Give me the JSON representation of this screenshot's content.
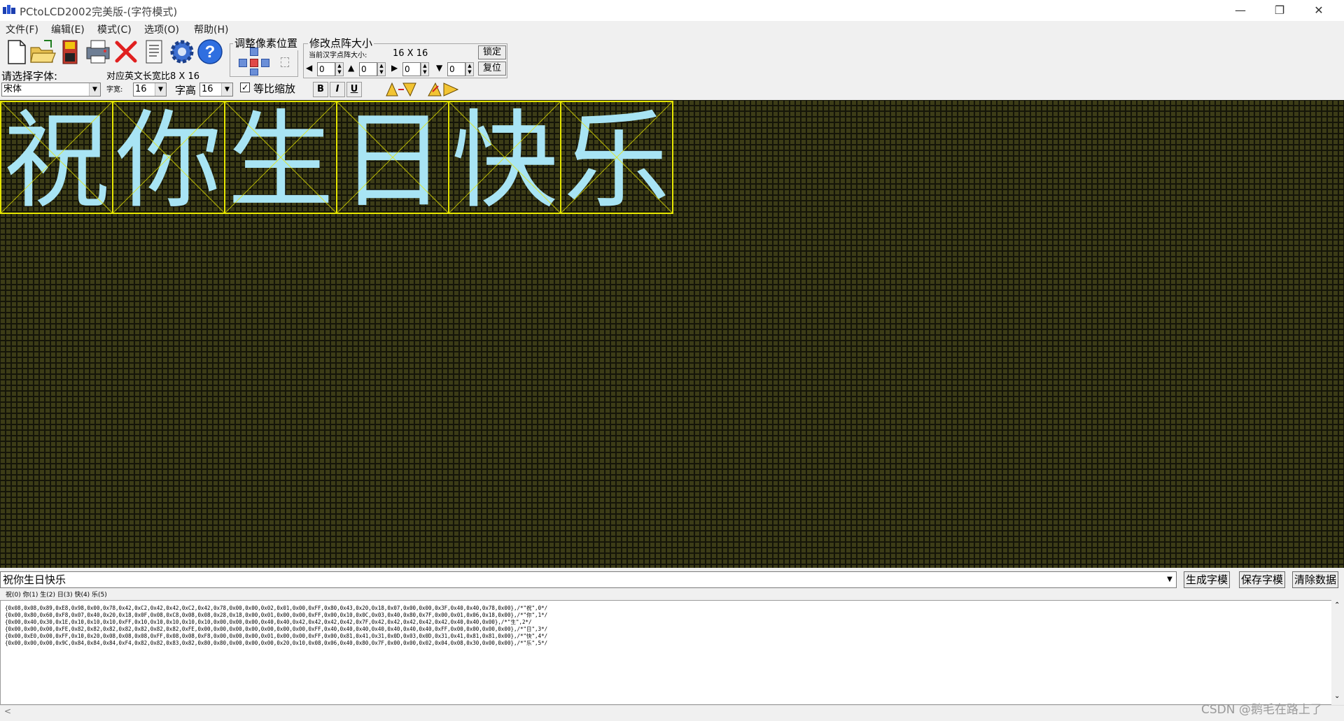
{
  "window": {
    "title": "PCtoLCD2002完美版-(字符模式)",
    "controls": [
      "minimize-icon",
      "restore-icon",
      "close-icon"
    ]
  },
  "menu": [
    "文件(F)",
    "编辑(E)",
    "模式(C)",
    "选项(O)",
    "帮助(H)"
  ],
  "toolbar": {
    "buttons": [
      "new-file-icon",
      "open-folder-icon",
      "save-disk-icon",
      "print-icon",
      "delete-x-icon",
      "document-icon",
      "gear-icon",
      "help-icon"
    ],
    "font_label": "请选择字体:",
    "font_value": "宋体",
    "ratio_label": "对应英文长宽比8 X 16",
    "width_label": "字宽:",
    "width_value": "16",
    "height_label": "字高",
    "height_value": "16",
    "proportional_label": "等比缩放",
    "proportional_checked": true,
    "format_buttons": [
      "B",
      "I",
      "U"
    ],
    "adjust_pixel_group": "调整像素位置",
    "matrix_group": "修改点阵大小",
    "current_matrix_label": "当前汉字点阵大小:",
    "current_matrix_value": "16 X 16",
    "lock_button": "锁定",
    "reset_button": "复位",
    "spin_values": [
      "0",
      "0",
      "0",
      "0"
    ]
  },
  "canvas": {
    "characters": [
      "祝",
      "你",
      "生",
      "日",
      "快",
      "乐"
    ],
    "background_color": "#3b3b16",
    "pixel_on_color": "#a8e4f4",
    "frame_color": "#e6e600"
  },
  "bottom": {
    "input_text": "祝你生日快乐",
    "generate_button": "生成字模",
    "save_button": "保存字模",
    "clear_button": "清除数据",
    "char_list": "祝(0)  你(1)  生(2)  日(3)  快(4)  乐(5)",
    "output_lines": [
      "{0x08,0x08,0x89,0xE8,0x98,0x00,0x78,0x42,0xC2,0x42,0x42,0xC2,0x42,0x78,0x00,0x00,0x02,0x01,0x00,0xFF,0x80,0x43,0x20,0x18,0x07,0x00,0x00,0x3F,0x40,0x40,0x78,0x00},/*\"祝\",0*/",
      "{0x00,0x80,0x60,0xF8,0x07,0x40,0x20,0x18,0x0F,0x08,0xC8,0x08,0x08,0x28,0x18,0x00,0x01,0x00,0x00,0xFF,0x00,0x10,0x0C,0x03,0x40,0x80,0x7F,0x00,0x01,0x06,0x18,0x00},/*\"你\",1*/",
      "{0x00,0x40,0x30,0x1E,0x10,0x10,0x10,0xFF,0x10,0x10,0x10,0x10,0x10,0x00,0x00,0x00,0x40,0x40,0x42,0x42,0x42,0x42,0x7F,0x42,0x42,0x42,0x42,0x42,0x40,0x40,0x00},/*\"生\",2*/",
      "{0x00,0x00,0x00,0xFE,0x82,0x82,0x82,0x82,0x82,0x82,0x82,0xFE,0x00,0x00,0x00,0x00,0x00,0x00,0x00,0xFF,0x40,0x40,0x40,0x40,0x40,0x40,0x40,0xFF,0x00,0x00,0x00,0x00},/*\"日\",3*/",
      "{0x00,0xE0,0x00,0xFF,0x10,0x20,0x08,0x08,0x08,0xFF,0x08,0x08,0xF8,0x00,0x00,0x00,0x01,0x00,0x00,0xFF,0x00,0x81,0x41,0x31,0x0D,0x03,0x0D,0x31,0x41,0x81,0x81,0x00},/*\"快\",4*/",
      "{0x00,0x00,0x00,0x9C,0x84,0x84,0x84,0xF4,0x82,0x82,0x83,0x82,0x80,0x80,0x00,0x00,0x00,0x20,0x10,0x08,0x06,0x40,0x80,0x7F,0x00,0x00,0x02,0x04,0x08,0x30,0x00,0x00},/*\"乐\",5*/"
    ]
  },
  "watermark": "CSDN @鹅毛在路上了"
}
